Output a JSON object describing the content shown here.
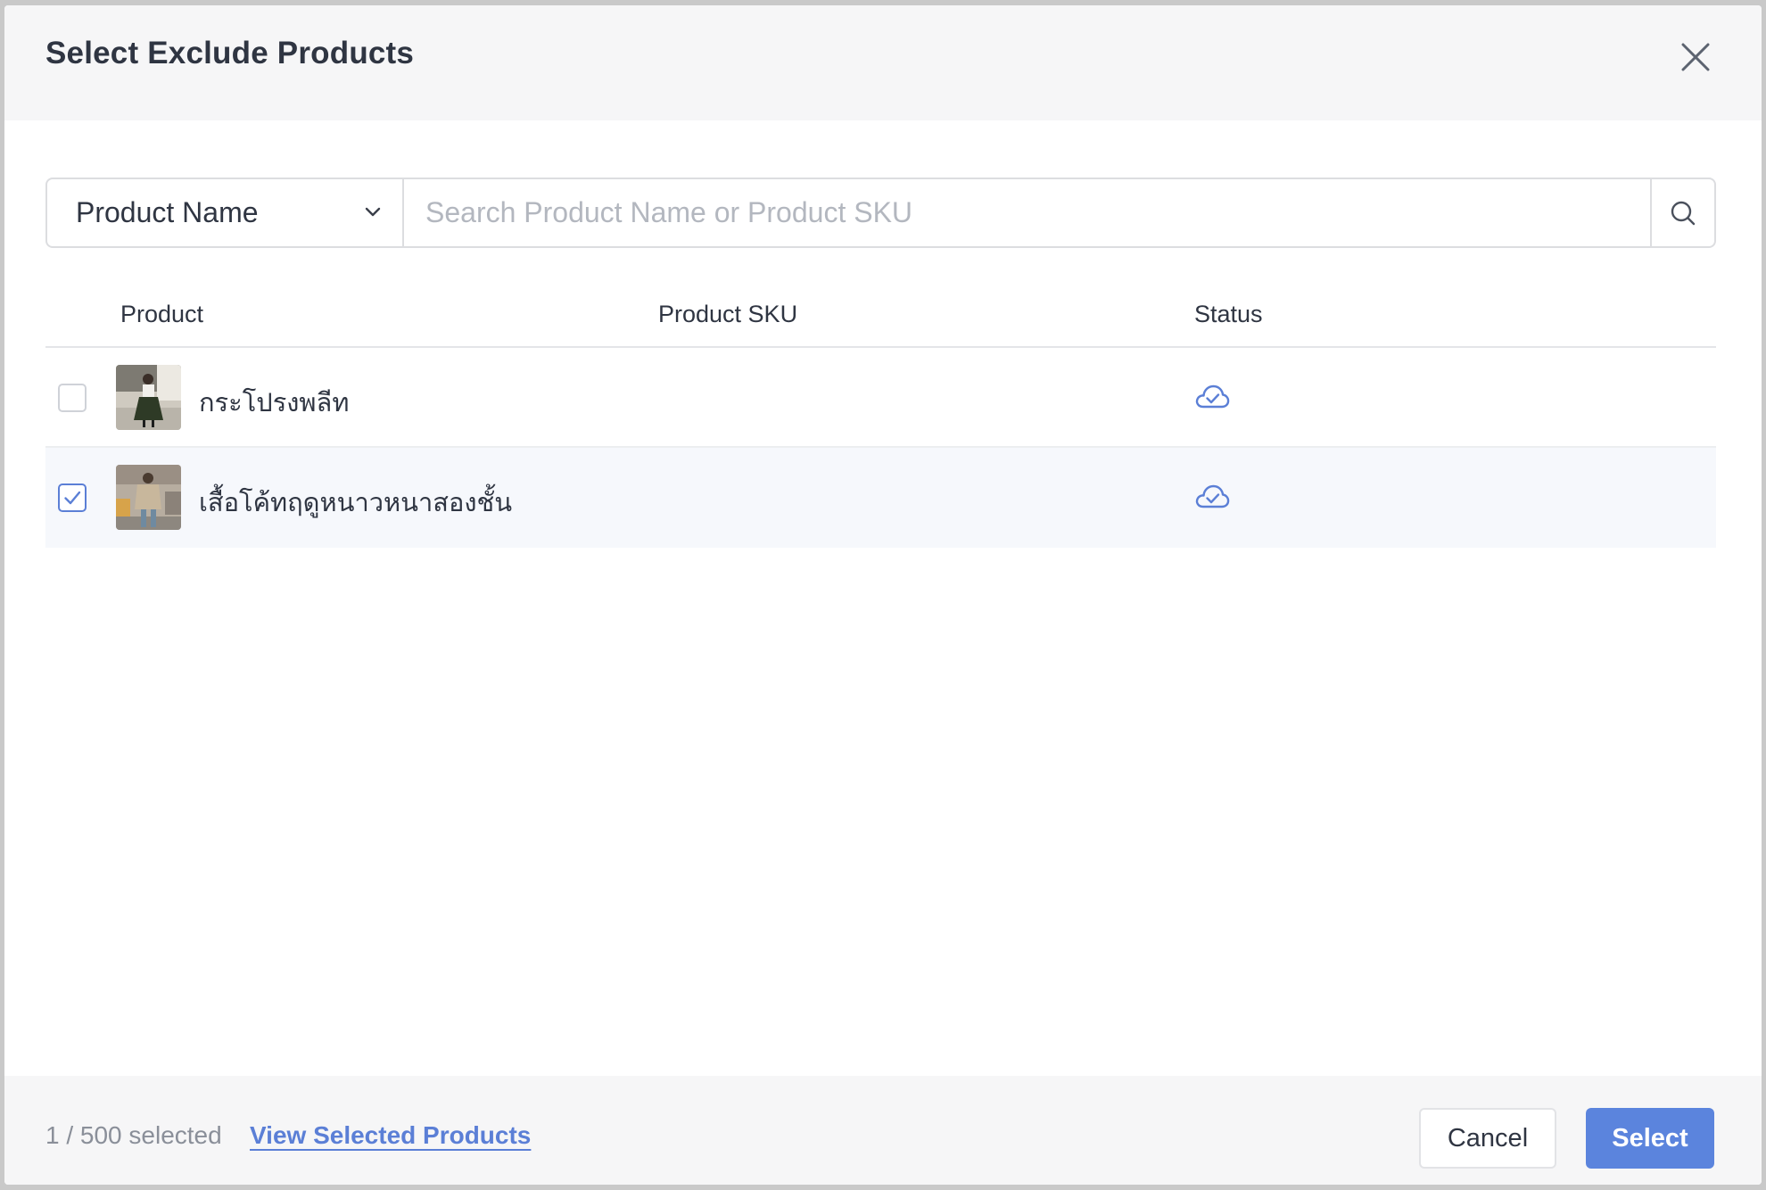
{
  "dialog": {
    "title": "Select Exclude Products",
    "close_icon": "close-icon"
  },
  "search": {
    "field_selected": "Product Name",
    "placeholder": "Search Product Name or Product SKU",
    "value": ""
  },
  "table": {
    "columns": [
      "Product",
      "Product SKU",
      "Status"
    ],
    "rows": [
      {
        "checked": false,
        "name": "กระโปรงพลีท",
        "sku": "",
        "status_icon": "cloud-check-icon"
      },
      {
        "checked": true,
        "name": "เสื้อโค้ทฤดูหนาวหนาสองชั้น",
        "sku": "",
        "status_icon": "cloud-check-icon"
      }
    ]
  },
  "footer": {
    "selected_count": "1 / 500 selected",
    "view_selected_label": "View Selected Products",
    "cancel_label": "Cancel",
    "select_label": "Select"
  },
  "colors": {
    "accent": "#5b84dd",
    "link": "#5b7fd6",
    "header_bg": "#f6f6f7"
  }
}
